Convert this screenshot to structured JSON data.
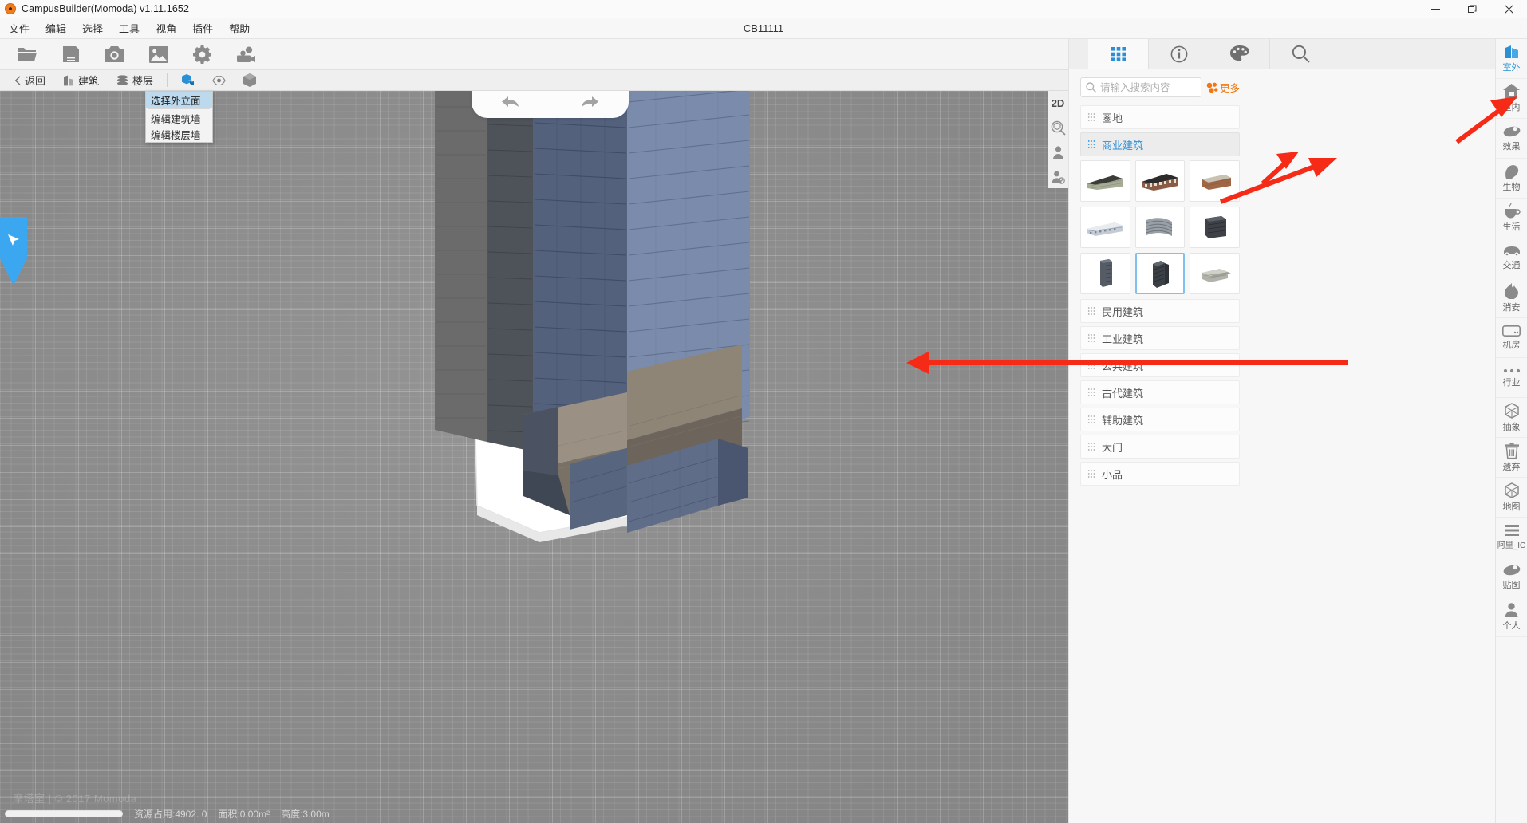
{
  "window": {
    "title": "CampusBuilder(Momoda) v1.11.1652",
    "app_logo": "momoda-logo-icon",
    "minimize": "—",
    "maximize": "❐",
    "close": "✕"
  },
  "menubar": {
    "items": [
      {
        "label": "文件",
        "name": "menu-file"
      },
      {
        "label": "编辑",
        "name": "menu-edit"
      },
      {
        "label": "选择",
        "name": "menu-select"
      },
      {
        "label": "工具",
        "name": "menu-tools"
      },
      {
        "label": "视角",
        "name": "menu-view"
      },
      {
        "label": "插件",
        "name": "menu-plugins"
      },
      {
        "label": "帮助",
        "name": "menu-help"
      }
    ],
    "project_title": "CB11111"
  },
  "toolbar": {
    "buttons": [
      {
        "icon": "folder-open-icon",
        "name": "open-project-button"
      },
      {
        "icon": "save-icon",
        "name": "save-project-button"
      },
      {
        "icon": "camera-icon",
        "name": "screenshot-button"
      },
      {
        "icon": "image-icon",
        "name": "image-button"
      },
      {
        "icon": "gear-icon",
        "name": "settings-button"
      },
      {
        "icon": "video-record-icon",
        "name": "record-button"
      }
    ]
  },
  "context_toolbar": {
    "back": {
      "label": "返回",
      "icon": "chevron-left-icon"
    },
    "building": {
      "label": "建筑",
      "icon": "building-icon"
    },
    "floor": {
      "label": "楼层",
      "icon": "layers-icon"
    },
    "facade": {
      "icon": "cube-facade-icon",
      "active": true
    },
    "visibility": {
      "icon": "eye-icon"
    },
    "cube": {
      "icon": "cube-icon"
    }
  },
  "dropdown": {
    "items": [
      {
        "label": "选择外立面",
        "selected": true
      },
      {
        "label": "编辑建筑墙",
        "selected": false
      },
      {
        "label": "编辑楼层墙",
        "selected": false
      }
    ]
  },
  "viewport": {
    "undo_icon": "undo-arrow-icon",
    "redo_icon": "redo-arrow-icon",
    "tools": [
      {
        "label": "2D",
        "name": "view-2d-toggle"
      },
      {
        "label": "",
        "name": "zoom-extents-icon"
      },
      {
        "label": "",
        "name": "person-view-icon"
      },
      {
        "label": "",
        "name": "person-disabled-icon"
      }
    ],
    "cursor_icon": "cursor-arrow-icon"
  },
  "statusbar": {
    "resource_usage": "资源占用:4902. 0",
    "area": "面积:0.00m²",
    "height": "高度:3.00m",
    "watermark": "摩塔室 | © 2017 Momoda",
    "progress_percent": 100
  },
  "right_panel": {
    "tabs": [
      {
        "icon": "grid-apps-icon",
        "name": "tab-resources",
        "active": true
      },
      {
        "icon": "info-icon",
        "name": "tab-info",
        "active": false
      },
      {
        "icon": "palette-icon",
        "name": "tab-material",
        "active": false
      },
      {
        "icon": "search-icon",
        "name": "tab-search",
        "active": false
      }
    ],
    "search": {
      "placeholder": "请输入搜索内容",
      "value": "",
      "icon": "search-icon"
    },
    "more_button": {
      "label": "更多",
      "icon": "more-blocks-icon"
    },
    "categories": [
      {
        "label": "圏地",
        "active": false,
        "expanded": false
      },
      {
        "label": "商业建筑",
        "active": true,
        "expanded": true
      },
      {
        "label": "民用建筑",
        "active": false,
        "expanded": false
      },
      {
        "label": "工业建筑",
        "active": false,
        "expanded": false
      },
      {
        "label": "公共建筑",
        "active": false,
        "expanded": false
      },
      {
        "label": "古代建筑",
        "active": false,
        "expanded": false
      },
      {
        "label": "辅助建筑",
        "active": false,
        "expanded": false
      },
      {
        "label": "大门",
        "active": false,
        "expanded": false
      },
      {
        "label": "小品",
        "active": false,
        "expanded": false
      }
    ],
    "thumbnails": [
      {
        "name": "model-thumb-1",
        "selected": false,
        "tone": "#9aa08e",
        "shape": "long-low"
      },
      {
        "name": "model-thumb-2",
        "selected": false,
        "tone": "#6d5a4d",
        "shape": "long-low"
      },
      {
        "name": "model-thumb-3",
        "selected": false,
        "tone": "#9a6a53",
        "shape": "block"
      },
      {
        "name": "model-thumb-4",
        "selected": false,
        "tone": "#b9c2cc",
        "shape": "long-low"
      },
      {
        "name": "model-thumb-5",
        "selected": false,
        "tone": "#8e949b",
        "shape": "curved"
      },
      {
        "name": "model-thumb-6",
        "selected": false,
        "tone": "#44474c",
        "shape": "block"
      },
      {
        "name": "model-thumb-7",
        "selected": false,
        "tone": "#5b6168",
        "shape": "tower"
      },
      {
        "name": "model-thumb-8",
        "selected": true,
        "tone": "#3e434a",
        "shape": "tower"
      },
      {
        "name": "model-thumb-9",
        "selected": false,
        "tone": "#a9aca4",
        "shape": "stack"
      }
    ]
  },
  "rail": {
    "items": [
      {
        "label": "室外",
        "icon": "outdoor-building-icon",
        "active": true
      },
      {
        "label": "室内",
        "icon": "indoor-home-icon",
        "active": false
      },
      {
        "label": "效果",
        "icon": "effect-icon",
        "active": false
      },
      {
        "label": "生物",
        "icon": "creature-head-icon",
        "active": false
      },
      {
        "label": "生活",
        "icon": "cup-icon",
        "active": false
      },
      {
        "label": "交通",
        "icon": "car-icon",
        "active": false
      },
      {
        "label": "消安",
        "icon": "flame-icon",
        "active": false
      },
      {
        "label": "机房",
        "icon": "server-icon",
        "active": false
      },
      {
        "label": "行业",
        "icon": "ellipsis-icon",
        "active": false
      },
      {
        "label": "抽象",
        "icon": "wireframe-cube-icon",
        "active": false
      },
      {
        "label": "遗弃",
        "icon": "trash-icon",
        "active": false
      },
      {
        "label": "地图",
        "icon": "wireframe-cube-icon",
        "active": false
      },
      {
        "label": "阿里_IC",
        "icon": "list-lines-icon",
        "active": false
      },
      {
        "label": "贴图",
        "icon": "texture-icon",
        "active": false
      },
      {
        "label": "个人",
        "icon": "person-icon",
        "active": false
      }
    ]
  },
  "annotations": [
    {
      "name": "annotation-arrow-to-category",
      "color": "#f52a17"
    },
    {
      "name": "annotation-arrow-to-thumbnail",
      "color": "#f52a17"
    },
    {
      "name": "annotation-arrow-to-outdoor-rail",
      "color": "#f52a17"
    },
    {
      "name": "annotation-arrow-to-person-tool",
      "color": "#f52a17"
    }
  ]
}
